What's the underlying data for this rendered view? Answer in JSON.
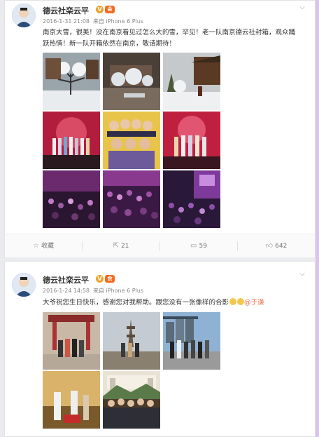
{
  "posts": [
    {
      "username": "德云社栾云平",
      "verified_badge": "V",
      "vip_badge": "会",
      "timestamp": "2016-1-31 21:08",
      "source_prefix": "来自",
      "source": "iPhone 6 Plus",
      "text": "南京大雪，很美！没在南京看见过怎么大的雪，罕见！老一队南京德云社封箱，观众踊跃热情！新一队开箱依然在南京，敬请期待！",
      "photos": [
        "snow-tree",
        "snow-courtyard",
        "snow-temple",
        "stage-group-red",
        "group-portrait-yellow",
        "stage-group-red-2",
        "audience-purple",
        "audience-purple-2",
        "audience-purple-3"
      ],
      "actions": {
        "favorite_label": "收藏",
        "repost_count": "21",
        "comment_count": "59",
        "like_count": "642"
      }
    },
    {
      "username": "德云社栾云平",
      "verified_badge": "V",
      "vip_badge": "会",
      "timestamp": "2016-1-24 14:58",
      "source_prefix": "来自",
      "source": "iPhone 6 Plus",
      "text_main": "大爷祝您生日快乐，感谢您对我帮助。跟您没有一张像样的合影",
      "mention": "@于谦",
      "photos": [
        "group-gate",
        "group-tower",
        "group-city",
        "stage-pair",
        "group-gate-2"
      ]
    }
  ],
  "icons": {
    "chevron": "chevron-down-icon",
    "favorite": "star-icon",
    "repost": "repost-icon",
    "comment": "comment-icon",
    "like": "thumbs-up-icon"
  },
  "colors": {
    "mention": "#eb7350",
    "vip_badge": "#f26b1f",
    "verified_badge": "#f0a12b"
  }
}
